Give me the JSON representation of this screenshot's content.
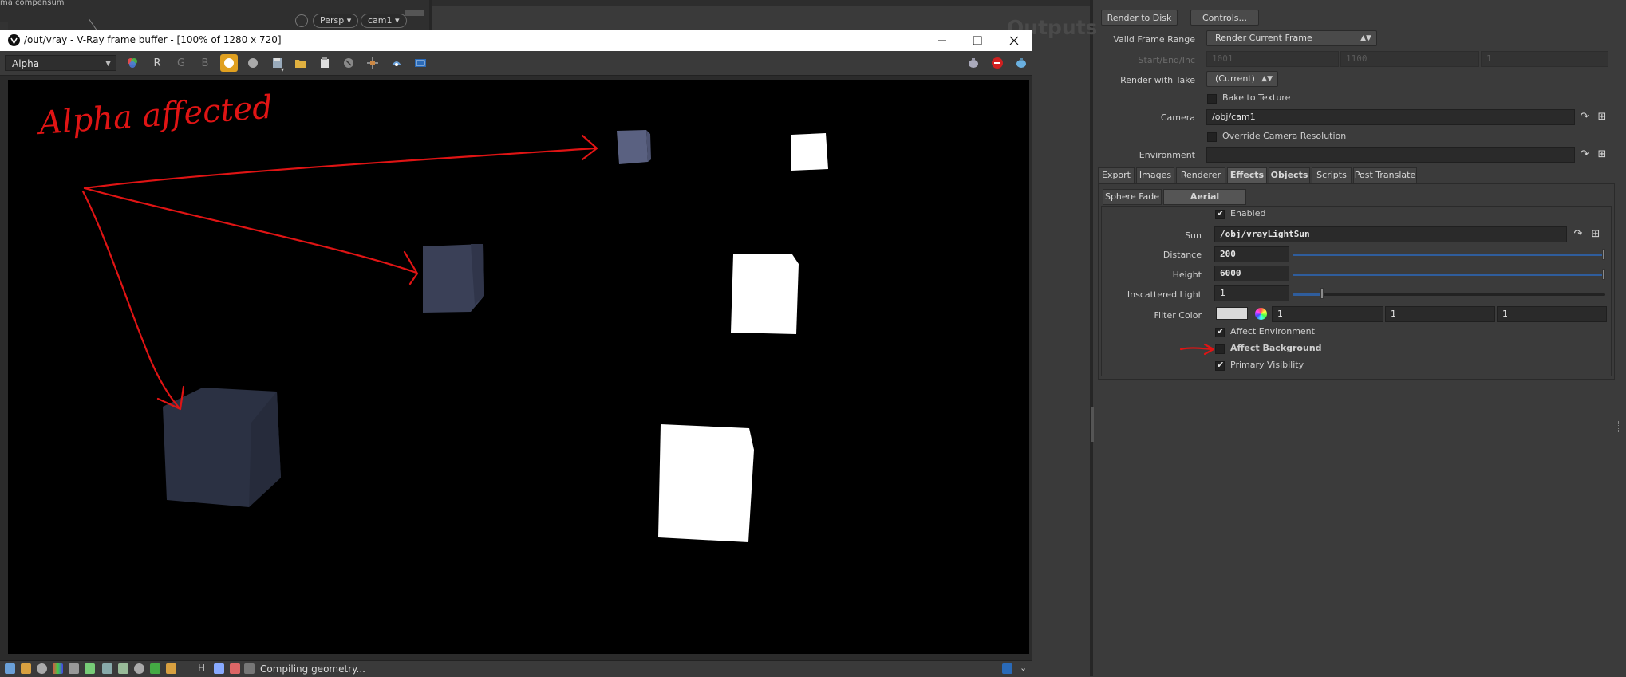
{
  "background": {
    "viewport_label": "ma compensum",
    "viewport_menu": "Persp",
    "camera_menu": "cam1",
    "outputs_ghost": "Outputs"
  },
  "framebuffer": {
    "title": "/out/vray - V-Ray frame buffer - [100% of 1280 x 720]",
    "channel": "Alpha",
    "channel_buttons": [
      "R",
      "G",
      "B"
    ],
    "status": "Compiling geometry...",
    "annotation_text": "Alpha affected",
    "cubes": [
      {
        "name": "cube-far-left",
        "color": "#5a6181"
      },
      {
        "name": "cube-mid-left",
        "color": "#3a4057"
      },
      {
        "name": "cube-near-left",
        "color": "#2b3143"
      },
      {
        "name": "cube-far-right",
        "color": "#ffffff"
      },
      {
        "name": "cube-mid-right",
        "color": "#ffffff"
      },
      {
        "name": "cube-near-right",
        "color": "#ffffff"
      }
    ],
    "annotation_color": "#e01414"
  },
  "panel": {
    "render_to_disk": "Render to Disk",
    "controls": "Controls...",
    "valid_frame_range_label": "Valid Frame Range",
    "valid_frame_range_value": "Render Current Frame",
    "start_end_inc_label": "Start/End/Inc",
    "start_end_inc_values": [
      "1001",
      "1100",
      "1"
    ],
    "render_with_take_label": "Render with Take",
    "render_with_take_value": "(Current)",
    "bake_to_texture": "Bake to Texture",
    "camera_label": "Camera",
    "camera_value": "/obj/cam1",
    "override_cam_res": "Override Camera Resolution",
    "environment_label": "Environment",
    "environment_value": "",
    "main_tabs": [
      "Export",
      "Images",
      "Renderer",
      "Effects",
      "Objects",
      "Scripts",
      "Post Translate"
    ],
    "sub_tabs": [
      "Sphere Fade",
      "Aerial Perspective"
    ],
    "enabled": "Enabled",
    "sun_label": "Sun",
    "sun_value": "/obj/vrayLightSun",
    "distance_label": "Distance",
    "distance_value": "200",
    "height_label": "Height",
    "height_value": "6000",
    "inscattered_label": "Inscattered Light",
    "inscattered_value": "1",
    "filter_color_label": "Filter Color",
    "filter_color_values": [
      "1",
      "1",
      "1"
    ],
    "affect_environment": "Affect Environment",
    "affect_background": "Affect Background",
    "primary_visibility": "Primary Visibility",
    "distance_level": 1.0,
    "height_level": 1.0,
    "inscattered_level": 0.1
  }
}
